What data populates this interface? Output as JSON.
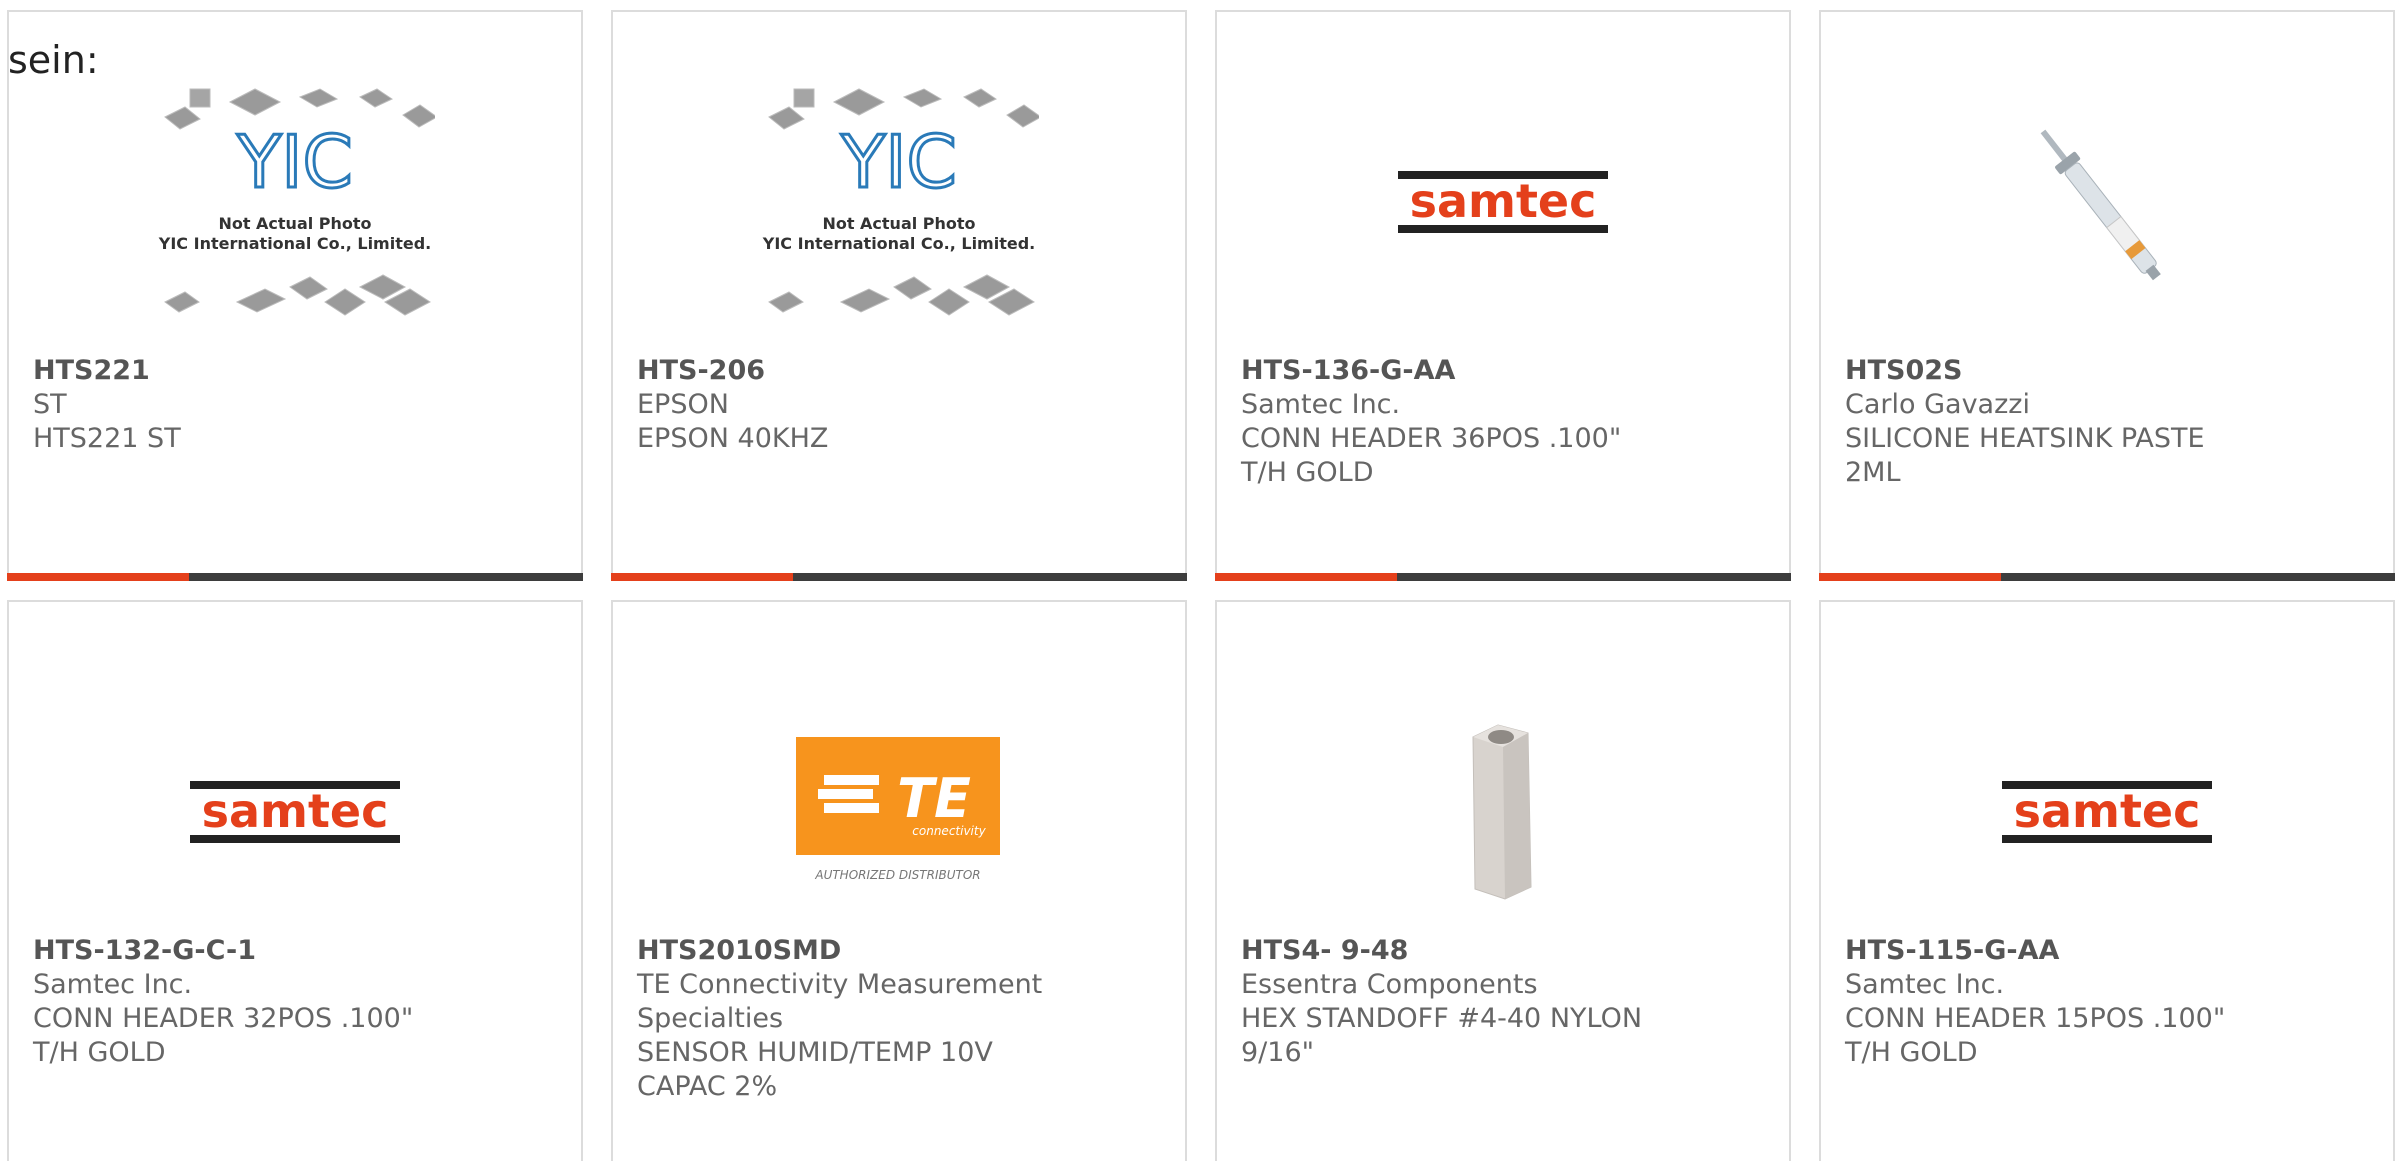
{
  "heading": "sein:",
  "yic": {
    "line1": "Not Actual Photo",
    "line2": "YIC International Co., Limited."
  },
  "samtec_logo": "samtec",
  "te_logo": {
    "name": "TE",
    "sub": "connectivity",
    "caption": "AUTHORIZED DISTRIBUTOR"
  },
  "colors": {
    "accent": "#e4401b",
    "bar": "#3d3d3d",
    "samtec_red": "#e4401b",
    "te_orange": "#f7941d"
  },
  "products": [
    {
      "part": "HTS221",
      "maker": "ST",
      "desc": "HTS221 ST",
      "image": "yic-placeholder"
    },
    {
      "part": "HTS-206",
      "maker": "EPSON",
      "desc": "EPSON 40KHZ",
      "image": "yic-placeholder"
    },
    {
      "part": "HTS-136-G-AA",
      "maker": "Samtec Inc.",
      "desc": "CONN HEADER 36POS .100\" T/H GOLD",
      "image": "samtec-logo"
    },
    {
      "part": "HTS02S",
      "maker": "Carlo Gavazzi",
      "desc": "SILICONE HEATSINK PASTE 2ML",
      "image": "syringe"
    },
    {
      "part": "HTS-132-G-C-1",
      "maker": "Samtec Inc.",
      "desc": "CONN HEADER 32POS .100\" T/H GOLD",
      "image": "samtec-logo"
    },
    {
      "part": "HTS2010SMD",
      "maker": "TE Connectivity Measurement Specialties",
      "desc": "SENSOR HUMID/TEMP 10V CAPAC 2%",
      "image": "te-logo"
    },
    {
      "part": "HTS4- 9-48",
      "maker": "Essentra Components",
      "desc": "HEX STANDOFF #4-40 NYLON 9/16\"",
      "image": "hex-standoff"
    },
    {
      "part": "HTS-115-G-AA",
      "maker": "Samtec Inc.",
      "desc": "CONN HEADER 15POS .100\" T/H GOLD",
      "image": "samtec-logo"
    }
  ]
}
